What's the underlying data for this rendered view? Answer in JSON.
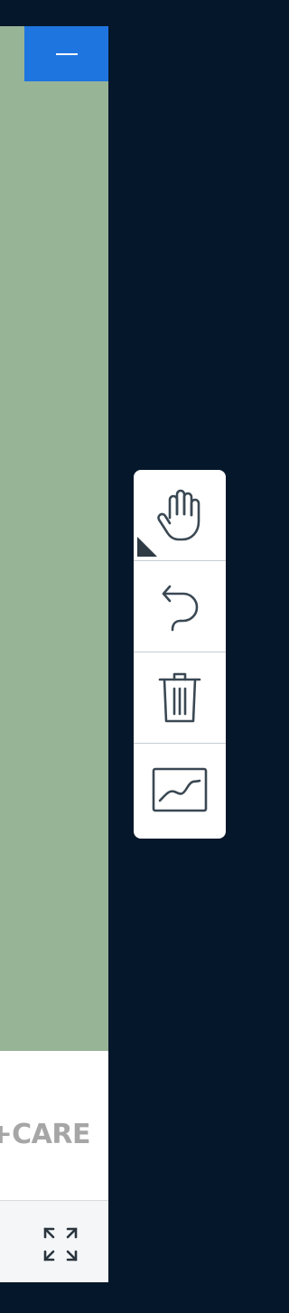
{
  "brand": {
    "text": "T+CARE"
  },
  "toolbar": {
    "tools": [
      {
        "icon": "hand-icon",
        "tooltip": ""
      },
      {
        "icon": "undo-icon",
        "tooltip": ""
      },
      {
        "icon": "trash-icon",
        "tooltip": ""
      },
      {
        "icon": "line-chart-icon",
        "tooltip": ""
      }
    ]
  },
  "colors": {
    "background": "#05172a",
    "panel": "#97b497",
    "accent": "#1f75e0",
    "brand_text": "#a6a6a6",
    "icon_stroke": "#3a4853"
  }
}
